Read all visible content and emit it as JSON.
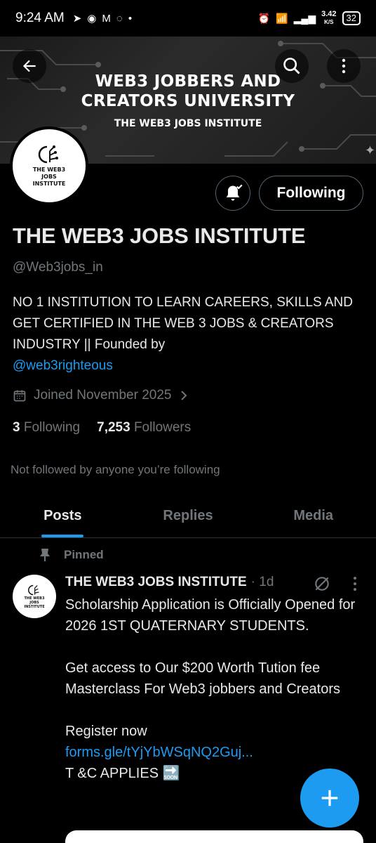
{
  "status_bar": {
    "time": "9:24 AM",
    "net_speed": "3.42",
    "net_unit": "K/S",
    "battery": "32"
  },
  "banner": {
    "title_line1": "WEB3 JOBBERS AND",
    "title_line2": "CREATORS UNIVERSITY",
    "subtitle": "THE WEB3 JOBS INSTITUTE"
  },
  "avatar": {
    "text": "THE WEB3 JOBS INSTITUTE"
  },
  "actions": {
    "following_label": "Following"
  },
  "profile": {
    "name": "THE WEB3 JOBS INSTITUTE",
    "handle": "@Web3jobs_in",
    "bio": "NO 1 INSTITUTION TO LEARN CAREERS, SKILLS AND GET CERTIFIED IN THE WEB 3 JOBS & CREATORS INDUSTRY || Founded by",
    "bio_mention": "@web3righteous",
    "joined": "Joined November 2025",
    "following_count": "3",
    "following_label": "Following",
    "followers_count": "7,253",
    "followers_label": "Followers",
    "not_followed": "Not followed by anyone you’re following"
  },
  "tabs": [
    {
      "label": "Posts",
      "active": true
    },
    {
      "label": "Replies",
      "active": false
    },
    {
      "label": "Media",
      "active": false
    }
  ],
  "post": {
    "pinned_label": "Pinned",
    "author": "THE WEB3 JOBS INSTITUTE",
    "meta": "· 1d",
    "body": "Scholarship Application is Officially Opened for 2026 1ST QUATERNARY STUDENTS.\n\nGet access to Our $200 Worth Tution fee Masterclass For Web3 jobbers and Creators\n\nRegister now",
    "link": "forms.gle/tYjYbWSqNQ2Guj...",
    "footer": "T &C APPLIES",
    "soon_emoji": "🔜",
    "avatar_text": "THE WEB3 JOBS INSTITUTE"
  },
  "colors": {
    "accent": "#1d9bf0",
    "background": "#000000",
    "muted": "#71767b",
    "text": "#e7e9ea"
  },
  "icons": [
    "back-arrow-icon",
    "search-icon",
    "more-vertical-icon",
    "bell-plus-icon",
    "calendar-icon",
    "chevron-right-icon",
    "pin-icon",
    "grok-icon",
    "more-vertical-icon",
    "plus-icon"
  ]
}
